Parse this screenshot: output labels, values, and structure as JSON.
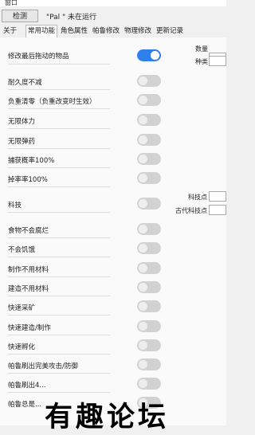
{
  "window": {
    "title": "窗口"
  },
  "toolbar": {
    "detect_label": "检测",
    "status_text": "\"Pal \" 未在运行"
  },
  "tabs": [
    {
      "label": "关于"
    },
    {
      "label": "常用功能",
      "active": true
    },
    {
      "label": "角色属性"
    },
    {
      "label": "帕鲁修改"
    },
    {
      "label": "物理修改"
    },
    {
      "label": "更新记录"
    }
  ],
  "options": [
    {
      "label": "修改最后拖动的物品",
      "on": true
    },
    {
      "label": "耐久度不减",
      "on": false
    },
    {
      "label": "负重清零（负重改变时生效）",
      "on": false
    },
    {
      "label": "无限体力",
      "on": false
    },
    {
      "label": "无限弹药",
      "on": false
    },
    {
      "label": "捕获概率100%",
      "on": false
    },
    {
      "label": "掉率率100%",
      "on": false
    },
    {
      "label": "科技",
      "on": false
    },
    {
      "label": "食物不会腐烂",
      "on": false
    },
    {
      "label": "不会饥饿",
      "on": false
    },
    {
      "label": "制作不用材料",
      "on": false
    },
    {
      "label": "建造不用材料",
      "on": false
    },
    {
      "label": "快速采矿",
      "on": false
    },
    {
      "label": "快速建造/制作",
      "on": false
    },
    {
      "label": "快速孵化",
      "on": false
    },
    {
      "label": "帕鲁刷出完美攻击/防御",
      "on": false
    },
    {
      "label": "帕鲁刷出4...",
      "on": false
    },
    {
      "label": "帕鲁总是...",
      "on": false
    }
  ],
  "right_fields": {
    "quantity_label": "数量",
    "kind_label": "种类",
    "tech_points_label": "科技点",
    "ancient_tech_points_label": "古代科技点"
  },
  "watermark": {
    "text": "有趣论坛"
  },
  "colors": {
    "toggle_on": "#2f80ed",
    "toggle_off": "#d2d2d2"
  }
}
